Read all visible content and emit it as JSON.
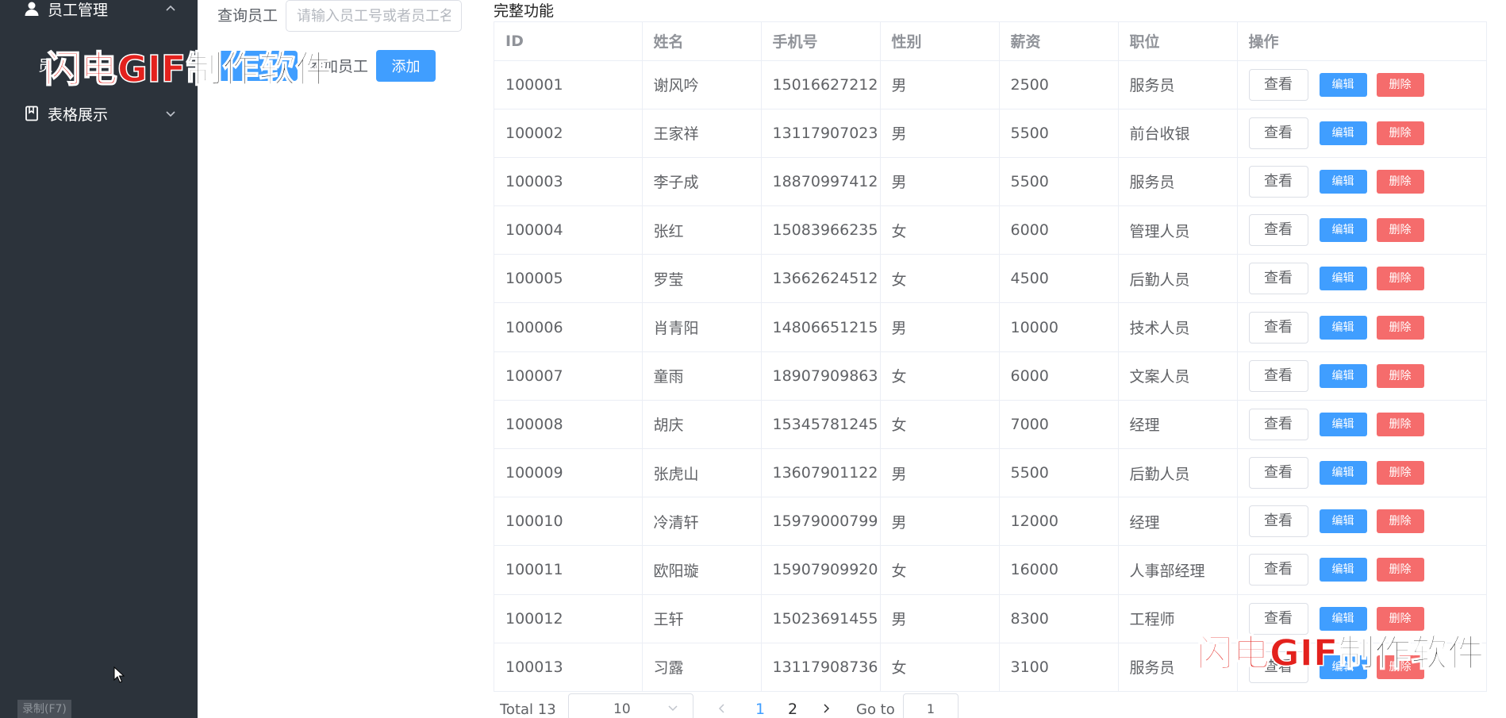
{
  "sidebar": {
    "menu_employee": "员工管理",
    "submenu_first_char": "员",
    "menu_table": "表格展示",
    "record_hint": "录制(F7)"
  },
  "controls": {
    "query_label": "查询员工",
    "query_placeholder": "请输入员工号或者员工名",
    "add_label": "添加员工",
    "add_button": "添加"
  },
  "table": {
    "title": "完整功能",
    "columns": [
      "ID",
      "姓名",
      "手机号",
      "性别",
      "薪资",
      "职位",
      "操作"
    ],
    "view_label": "查看",
    "edit_label": "编辑",
    "delete_label": "删除",
    "rows": [
      [
        "100001",
        "谢风吟",
        "15016627212",
        "男",
        "2500",
        "服务员"
      ],
      [
        "100002",
        "王家祥",
        "13117907023",
        "男",
        "5500",
        "前台收银"
      ],
      [
        "100003",
        "李子成",
        "18870997412",
        "男",
        "5500",
        "服务员"
      ],
      [
        "100004",
        "张红",
        "15083966235",
        "女",
        "6000",
        "管理人员"
      ],
      [
        "100005",
        "罗莹",
        "13662624512",
        "女",
        "4500",
        "后勤人员"
      ],
      [
        "100006",
        "肖青阳",
        "14806651215",
        "男",
        "10000",
        "技术人员"
      ],
      [
        "100007",
        "童雨",
        "18907909863",
        "女",
        "6000",
        "文案人员"
      ],
      [
        "100008",
        "胡庆",
        "15345781245",
        "女",
        "7000",
        "经理"
      ],
      [
        "100009",
        "张虎山",
        "13607901122",
        "男",
        "5500",
        "后勤人员"
      ],
      [
        "100010",
        "冷清轩",
        "15979000799",
        "男",
        "12000",
        "经理"
      ],
      [
        "100011",
        "欧阳璇",
        "15907909920",
        "女",
        "16000",
        "人事部经理"
      ],
      [
        "100012",
        "王轩",
        "15023691455",
        "男",
        "8300",
        "工程师"
      ],
      [
        "100013",
        "习露",
        "13117908736",
        "女",
        "3100",
        "服务员"
      ]
    ]
  },
  "pagination": {
    "total": "Total 13",
    "page_size": "10",
    "page1": "1",
    "page2": "2",
    "goto_label": "Go to",
    "goto_value": "1"
  },
  "watermark": {
    "red": "闪电GIF",
    "black": "制作软件"
  },
  "colors": {
    "sidebar_bg": "#2c333b",
    "primary": "#409eff",
    "danger": "#f56c6c",
    "watermark_red": "#e3211d"
  }
}
